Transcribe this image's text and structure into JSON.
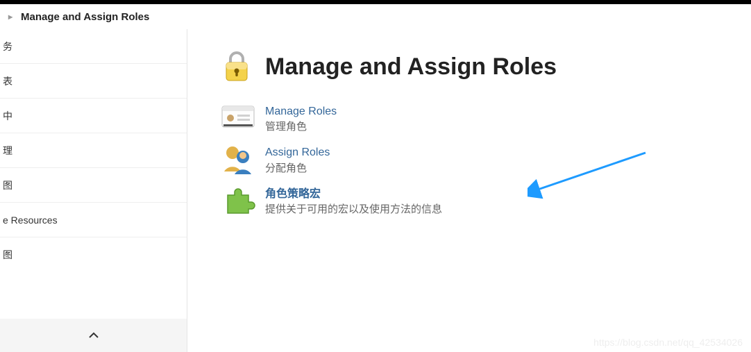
{
  "breadcrumb": {
    "title": "Manage and Assign Roles"
  },
  "sidebar": {
    "items": [
      {
        "label": "务"
      },
      {
        "label": "表"
      },
      {
        "label": "中"
      },
      {
        "label": "理"
      },
      {
        "label": "图"
      },
      {
        "label": "e Resources"
      },
      {
        "label": "图"
      }
    ]
  },
  "page": {
    "title": "Manage and Assign Roles"
  },
  "items": [
    {
      "title": "Manage Roles",
      "description": "管理角色",
      "icon": "id-card-icon",
      "bold": false
    },
    {
      "title": "Assign Roles",
      "description": "分配角色",
      "icon": "users-icon",
      "bold": false
    },
    {
      "title": "角色策略宏",
      "description": "提供关于可用的宏以及使用方法的信息",
      "icon": "puzzle-icon",
      "bold": true
    }
  ],
  "watermark": "https://blog.csdn.net/qq_42534026"
}
